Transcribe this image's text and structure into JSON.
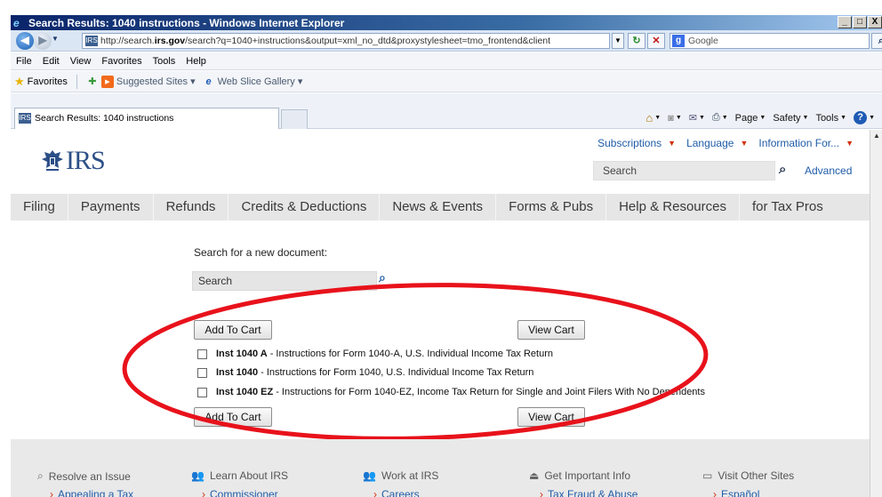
{
  "window": {
    "title": "Search Results: 1040 instructions - Windows Internet Explorer",
    "controls": [
      "_",
      "□",
      "X"
    ]
  },
  "addressbar": {
    "url_prefix": "http://search.",
    "url_domain": "irs.gov",
    "url_rest": "/search?q=1040+instructions&output=xml_no_dtd&proxystylesheet=tmo_frontend&client",
    "search_provider": "Google"
  },
  "menubar": {
    "items": [
      "File",
      "Edit",
      "View",
      "Favorites",
      "Tools",
      "Help"
    ]
  },
  "favbar": {
    "favorites": "Favorites",
    "suggested": "Suggested Sites ▾",
    "webslice": "Web Slice Gallery ▾"
  },
  "tabbar": {
    "active_tab": "Search Results: 1040 instructions",
    "page": "Page",
    "safety": "Safety",
    "tools": "Tools"
  },
  "site": {
    "logo_text": "IRS",
    "util_nav": [
      "Subscriptions",
      "Language",
      "Information For..."
    ],
    "search_placeholder": "Search",
    "advanced": "Advanced",
    "main_nav": [
      "Filing",
      "Payments",
      "Refunds",
      "Credits & Deductions",
      "News & Events",
      "Forms & Pubs",
      "Help & Resources",
      "for Tax Pros"
    ]
  },
  "main": {
    "search_label": "Search for a new document:",
    "search_placeholder": "Search",
    "add_to_cart": "Add To Cart",
    "view_cart": "View Cart",
    "documents": [
      {
        "name": "Inst 1040 A",
        "desc": "- Instructions for Form 1040-A, U.S. Individual Income Tax Return"
      },
      {
        "name": "Inst 1040",
        "desc": "- Instructions for Form 1040, U.S. Individual Income Tax Return"
      },
      {
        "name": "Inst 1040 EZ",
        "desc": "- Instructions for Form 1040-EZ, Income Tax Return for Single and Joint Filers With No Dependents"
      }
    ]
  },
  "footer": {
    "columns": [
      {
        "title": "Resolve an Issue",
        "sub": "Appealing a Tax"
      },
      {
        "title": "Learn About IRS",
        "sub": "Commissioner"
      },
      {
        "title": "Work at IRS",
        "sub": "Careers"
      },
      {
        "title": "Get Important Info",
        "sub": "Tax Fraud & Abuse"
      },
      {
        "title": "Visit Other Sites",
        "sub": "Español"
      }
    ]
  },
  "colors": {
    "annotation": "#e8121b",
    "link": "#1f5ca7",
    "nav_bg": "#e6e6e6"
  }
}
